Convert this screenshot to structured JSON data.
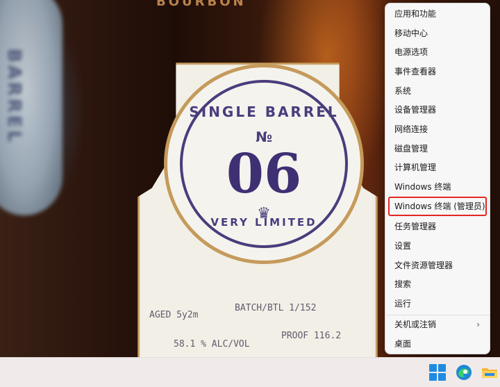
{
  "wallpaper": {
    "seal_top": "SINGLE BARREL",
    "seal_no": "№",
    "seal_number": "06",
    "seal_bottom": "VERY LIMITED",
    "stamp_aged": "AGED 5y2m",
    "stamp_batch": "BATCH/BTL 1/152",
    "stamp_abv": "58.1 % ALC/VOL",
    "stamp_proof": "PROOF 116.2",
    "left_label": "BARREL",
    "top_text": "BOURBON"
  },
  "menu": {
    "items": [
      {
        "label": "应用和功能"
      },
      {
        "label": "移动中心"
      },
      {
        "label": "电源选项"
      },
      {
        "label": "事件查看器"
      },
      {
        "label": "系统"
      },
      {
        "label": "设备管理器"
      },
      {
        "label": "网络连接"
      },
      {
        "label": "磁盘管理"
      },
      {
        "label": "计算机管理"
      },
      {
        "label": "Windows 终端"
      },
      {
        "label": "Windows 终端 (管理员)"
      },
      {
        "label": "任务管理器"
      },
      {
        "label": "设置"
      },
      {
        "label": "文件资源管理器"
      },
      {
        "label": "搜索"
      },
      {
        "label": "运行"
      },
      {
        "label": "关机或注销"
      },
      {
        "label": "桌面"
      }
    ],
    "highlight_color": "#e32722"
  },
  "taskbar": {
    "icons": [
      "windows-start-icon",
      "edge-browser-icon",
      "file-explorer-icon"
    ],
    "accent": "#1f8be0"
  }
}
